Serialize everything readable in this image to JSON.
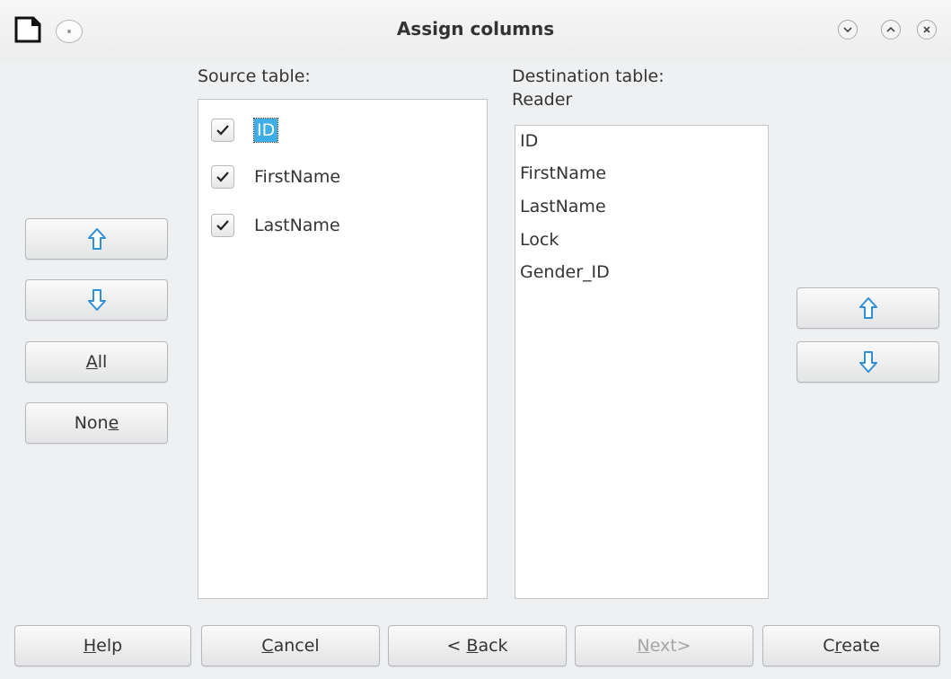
{
  "window": {
    "title": "Assign columns",
    "controls": [
      "minimize",
      "maximize",
      "close"
    ]
  },
  "source": {
    "label": "Source table:",
    "items": [
      {
        "label": "ID",
        "checked": true,
        "selected": true
      },
      {
        "label": "FirstName",
        "checked": true,
        "selected": false
      },
      {
        "label": "LastName",
        "checked": true,
        "selected": false
      }
    ]
  },
  "destination": {
    "label": "Destination table:",
    "table_name": "Reader",
    "items": [
      "ID",
      "FirstName",
      "LastName",
      "Lock",
      "Gender_ID"
    ]
  },
  "left_buttons": {
    "up_icon": "arrow-up-icon",
    "down_icon": "arrow-down-icon",
    "all": {
      "pre": "",
      "mn": "A",
      "post": "ll"
    },
    "none": {
      "pre": "Non",
      "mn": "e",
      "post": ""
    }
  },
  "right_buttons": {
    "up_icon": "arrow-up-icon",
    "down_icon": "arrow-down-icon"
  },
  "footer": {
    "help": {
      "pre": "",
      "mn": "H",
      "post": "elp"
    },
    "cancel": {
      "pre": "",
      "mn": "C",
      "post": "ancel"
    },
    "back": {
      "pre": "< ",
      "mn": "B",
      "post": "ack"
    },
    "next": {
      "pre": "",
      "mn": "N",
      "post": "ext>",
      "disabled": true
    },
    "create": {
      "pre": "C",
      "mn": "r",
      "post": "eate"
    }
  },
  "colors": {
    "background": "#eff0f1",
    "selection": "#3daee9",
    "arrow": "#2f8fd8"
  }
}
